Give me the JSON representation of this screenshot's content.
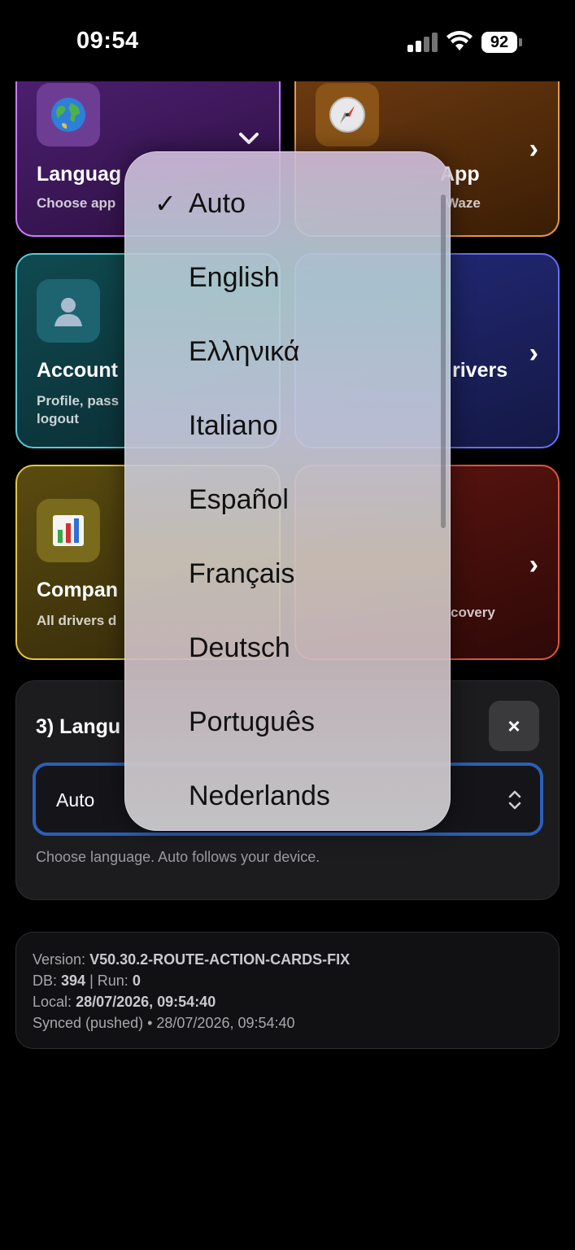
{
  "status_bar": {
    "time": "09:54",
    "battery": "92",
    "icons": [
      "cellular-signal-icon",
      "wifi-icon",
      "battery-icon"
    ]
  },
  "cards": {
    "language": {
      "title": "Languag",
      "subtitle": "Choose app",
      "icon": "globe-icon",
      "accent": "#c77dff"
    },
    "navigation": {
      "title": "App",
      "subtitle": "Waze",
      "icon": "compass-icon",
      "accent": "#e29a4e"
    },
    "account": {
      "title": "Account",
      "subtitle_line1": "Profile, pass",
      "subtitle_line2": "logout",
      "icon": "person-icon",
      "accent": "#5cc7d3"
    },
    "drivers": {
      "title": "rivers",
      "icon": "people-icon",
      "accent": "#6a6ef0"
    },
    "company": {
      "title": "Compan",
      "subtitle": "All drivers d",
      "icon": "bar-chart-icon",
      "accent": "#e3c741"
    },
    "security": {
      "subtitle": "covery",
      "icon": "shield-icon",
      "accent": "#e0553e"
    }
  },
  "language_panel": {
    "title": "3) Langu",
    "close_label": "×",
    "selected_value": "Auto",
    "hint": "Choose language. Auto follows your device."
  },
  "version_panel": {
    "version_label": "Version:",
    "version_value": "V50.30.2-ROUTE-ACTION-CARDS-FIX",
    "db_label": "DB:",
    "db_value": "394",
    "run_label": "| Run:",
    "run_value": "0",
    "local_label": "Local:",
    "local_value": "28/07/2026, 09:54:40",
    "synced": "Synced (pushed) • 28/07/2026, 09:54:40"
  },
  "language_menu": {
    "selected_index": 0,
    "options": [
      "Auto",
      "English",
      "Ελληνικά",
      "Italiano",
      "Español",
      "Français",
      "Deutsch",
      "Português",
      "Nederlands"
    ]
  }
}
